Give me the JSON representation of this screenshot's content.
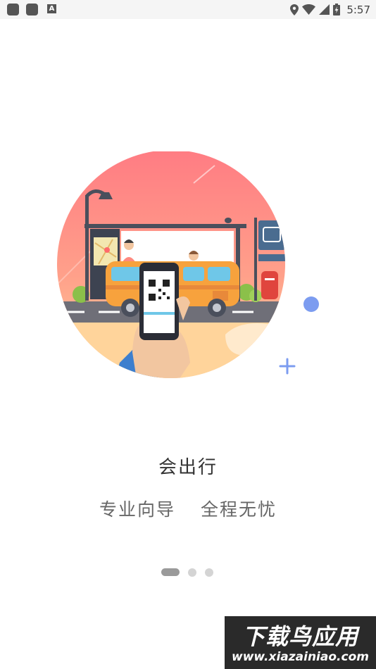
{
  "status_bar": {
    "time": "5:57",
    "notification_letter": "A",
    "icons": [
      "app-notification-icon",
      "app-notification-icon",
      "a-notification-icon",
      "location-icon",
      "wifi-icon",
      "signal-icon",
      "battery-icon"
    ]
  },
  "onboarding": {
    "title": "会出行",
    "subtitle_left": "专业向导",
    "subtitle_right": "全程无忧",
    "illustration": "bus-stop-qr-scan-illustration",
    "pages_total": 3,
    "current_page": 1
  },
  "watermark": {
    "brand": "下载鸟应用",
    "url": "www.xiazainiao.com"
  },
  "colors": {
    "circle_top": "#ff7c83",
    "circle_bottom": "#ffd39a",
    "bus": "#f7a23d",
    "accent_blue": "#7c9cf0",
    "indicator_active": "#9a9a9a",
    "indicator_inactive": "#d4d4d4"
  }
}
